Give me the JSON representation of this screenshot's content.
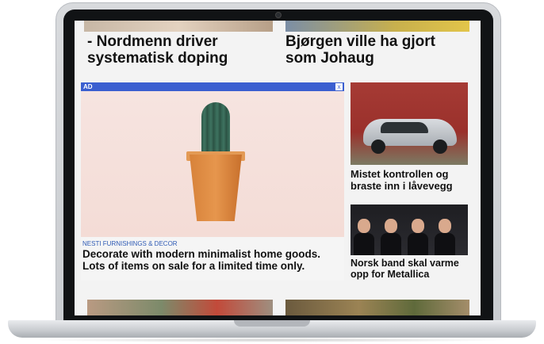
{
  "articles": {
    "top_left": {
      "headline": "- Nordmenn driver systematisk doping"
    },
    "top_right": {
      "headline": "Bjørgen ville ha gjort som Johaug"
    },
    "car": {
      "headline": "Mistet kontrollen og braste inn i låvevegg"
    },
    "band": {
      "headline": "Norsk band skal varme opp for Metallica"
    }
  },
  "ad": {
    "label": "AD",
    "close_glyph": "x",
    "sponsor": "NESTI FURNISHINGS & DECOR",
    "headline": "Decorate with modern minimalist home goods. Lots of items on sale for a limited time only."
  },
  "colors": {
    "ad_bar": "#3a5fd0",
    "sponsor_text": "#2f5bb5",
    "headline_text": "#111111"
  }
}
